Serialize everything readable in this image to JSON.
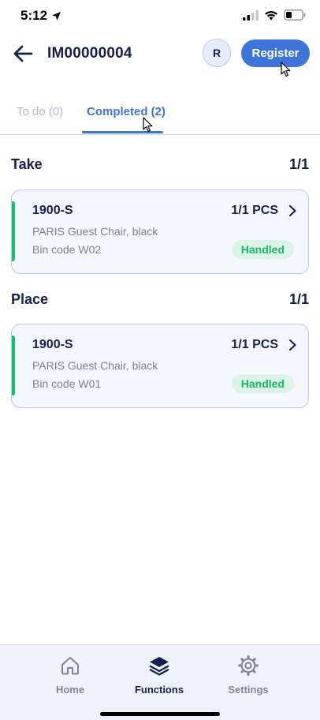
{
  "status_bar": {
    "time": "5:12"
  },
  "header": {
    "title": "IM00000004",
    "avatar_initial": "R",
    "register_label": "Register"
  },
  "tabs": [
    {
      "label": "To do (0)",
      "active": false
    },
    {
      "label": "Completed (2)",
      "active": true
    }
  ],
  "sections": [
    {
      "title": "Take",
      "count": "1/1",
      "item": {
        "code": "1900-S",
        "quantity": "1/1 PCS",
        "description": "PARIS Guest Chair, black",
        "bin": "Bin code W02",
        "status": "Handled"
      }
    },
    {
      "title": "Place",
      "count": "1/1",
      "item": {
        "code": "1900-S",
        "quantity": "1/1 PCS",
        "description": "PARIS Guest Chair, black",
        "bin": "Bin code W01",
        "status": "Handled"
      }
    }
  ],
  "bottom_nav": [
    {
      "label": "Home",
      "icon": "home-icon",
      "active": false
    },
    {
      "label": "Functions",
      "icon": "layers-icon",
      "active": true
    },
    {
      "label": "Settings",
      "icon": "gear-icon",
      "active": false
    }
  ],
  "colors": {
    "accent": "#3f74d9",
    "text_dark": "#14214a",
    "status_green": "#17c16a",
    "card_bg": "#f4f7fd"
  }
}
